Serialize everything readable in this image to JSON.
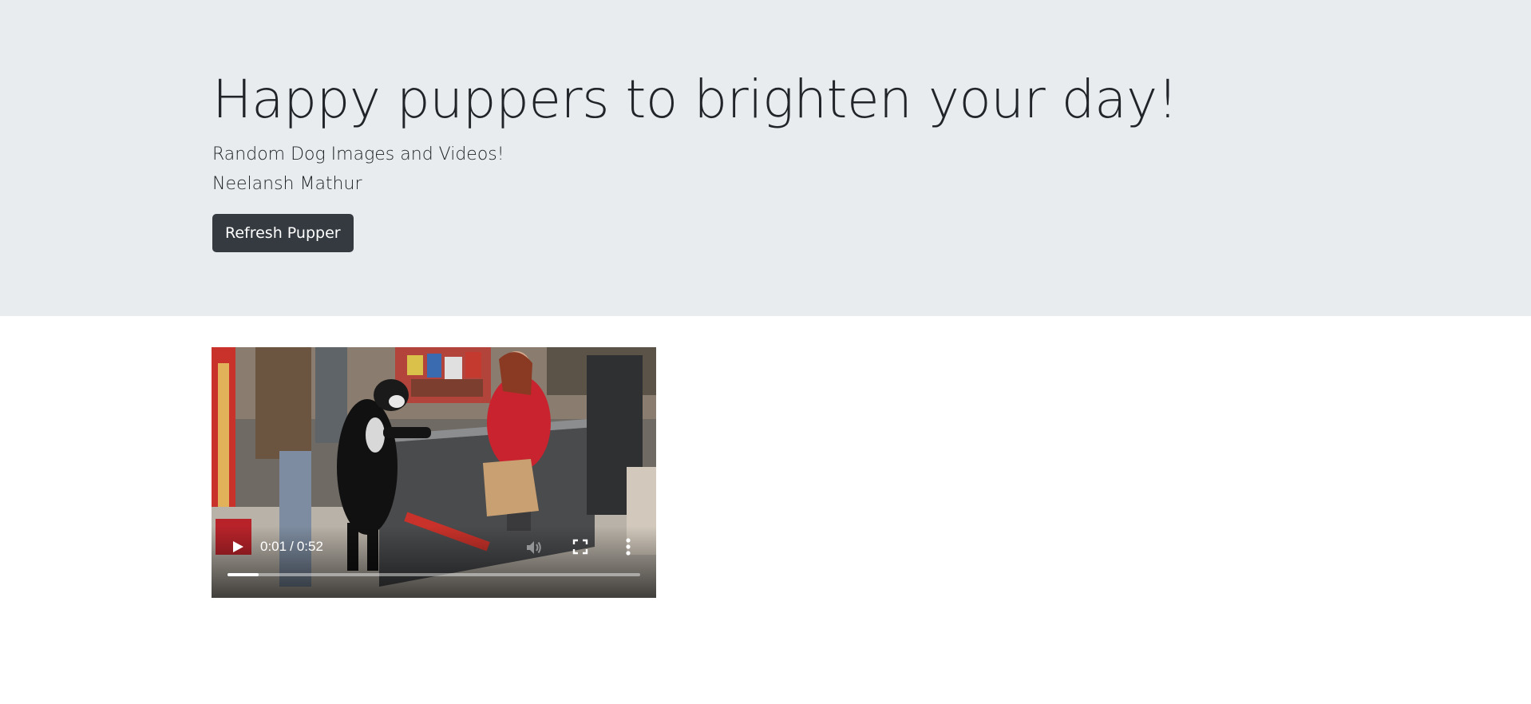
{
  "jumbotron": {
    "title": "Happy puppers to brighten your day!",
    "subtitle": "Random Dog Images and Videos!",
    "author": "Neelansh Mathur",
    "refresh_button": "Refresh Pupper"
  },
  "video": {
    "current_time": "0:01",
    "separator": "/",
    "duration": "0:52",
    "progress": 0.075,
    "controls": {
      "play": "play-icon",
      "mute": "volume-icon",
      "fullscreen": "fullscreen-icon",
      "more": "more-options-icon"
    }
  },
  "colors": {
    "jumbotron_bg": "#e9ecef",
    "button_bg": "#343a40",
    "text": "#212529"
  }
}
